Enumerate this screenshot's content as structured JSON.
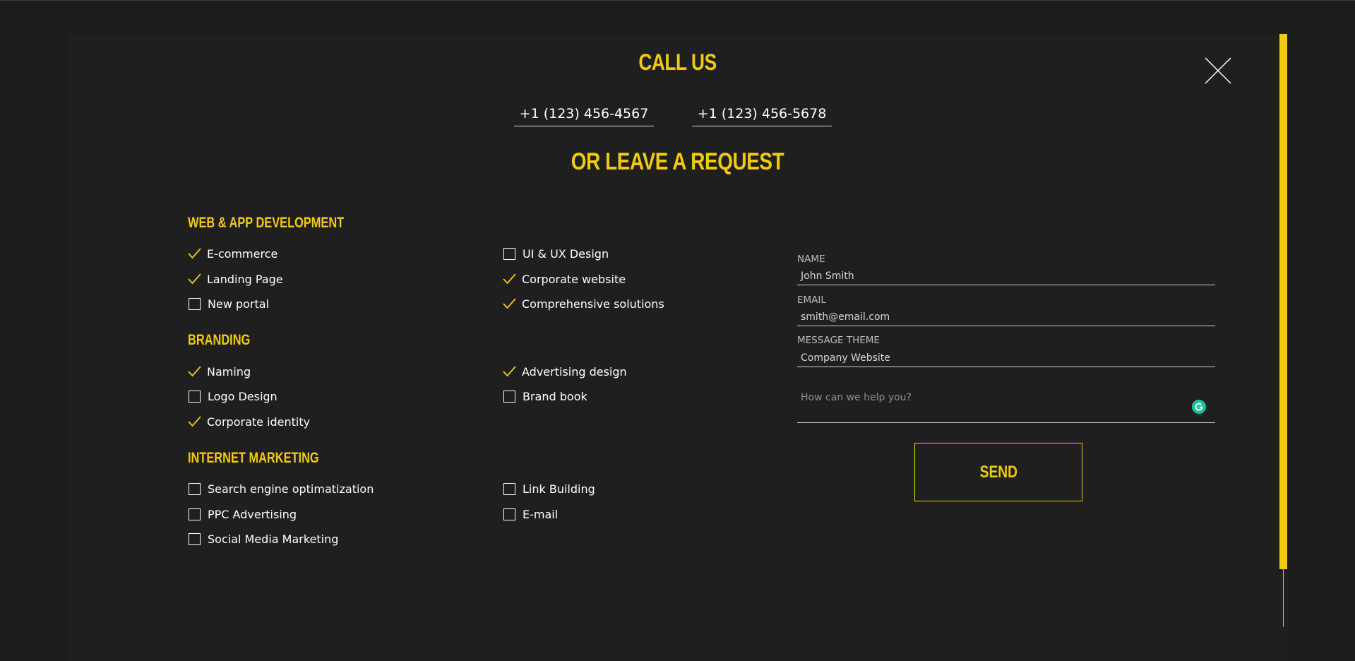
{
  "headings": {
    "call_us": "CALL US",
    "leave_request": "OR LEAVE A REQUEST"
  },
  "phones": [
    "+1 (123) 456-4567",
    "+1 (123) 456-5678"
  ],
  "sections": [
    {
      "title": "WEB & APP DEVELOPMENT",
      "options": [
        {
          "label": "E-commerce",
          "checked": true
        },
        {
          "label": "UI & UX Design",
          "checked": false
        },
        {
          "label": "Landing Page",
          "checked": true
        },
        {
          "label": "Corporate website",
          "checked": true
        },
        {
          "label": "New portal",
          "checked": false
        },
        {
          "label": "Comprehensive solutions",
          "checked": true
        }
      ]
    },
    {
      "title": "BRANDING",
      "options": [
        {
          "label": "Naming",
          "checked": true
        },
        {
          "label": "Advertising design",
          "checked": true
        },
        {
          "label": "Logo Design",
          "checked": false
        },
        {
          "label": "Brand book",
          "checked": false
        },
        {
          "label": "Corporate identity",
          "checked": true
        }
      ]
    },
    {
      "title": "INTERNET MARKETING",
      "options": [
        {
          "label": "Search engine optimatization",
          "checked": false
        },
        {
          "label": "Link Building",
          "checked": false
        },
        {
          "label": "PPC Advertising",
          "checked": false
        },
        {
          "label": "E-mail",
          "checked": false
        },
        {
          "label": "Social Media Marketing",
          "checked": false
        }
      ]
    }
  ],
  "form": {
    "name_label": "NAME",
    "name_value": "John Smith",
    "email_label": "EMAIL",
    "email_value": "smith@email.com",
    "theme_label": "MESSAGE THEME",
    "theme_value": "Company Website",
    "message_placeholder": "How can we help you?",
    "send_label": "SEND"
  },
  "colors": {
    "accent": "#f2cc0c",
    "background": "#1f1f1f",
    "grammarly": "#15c39a"
  },
  "icons": {
    "close": "close-icon",
    "checked": "check-icon",
    "unchecked": "checkbox-empty-icon",
    "grammarly": "grammarly-icon"
  }
}
